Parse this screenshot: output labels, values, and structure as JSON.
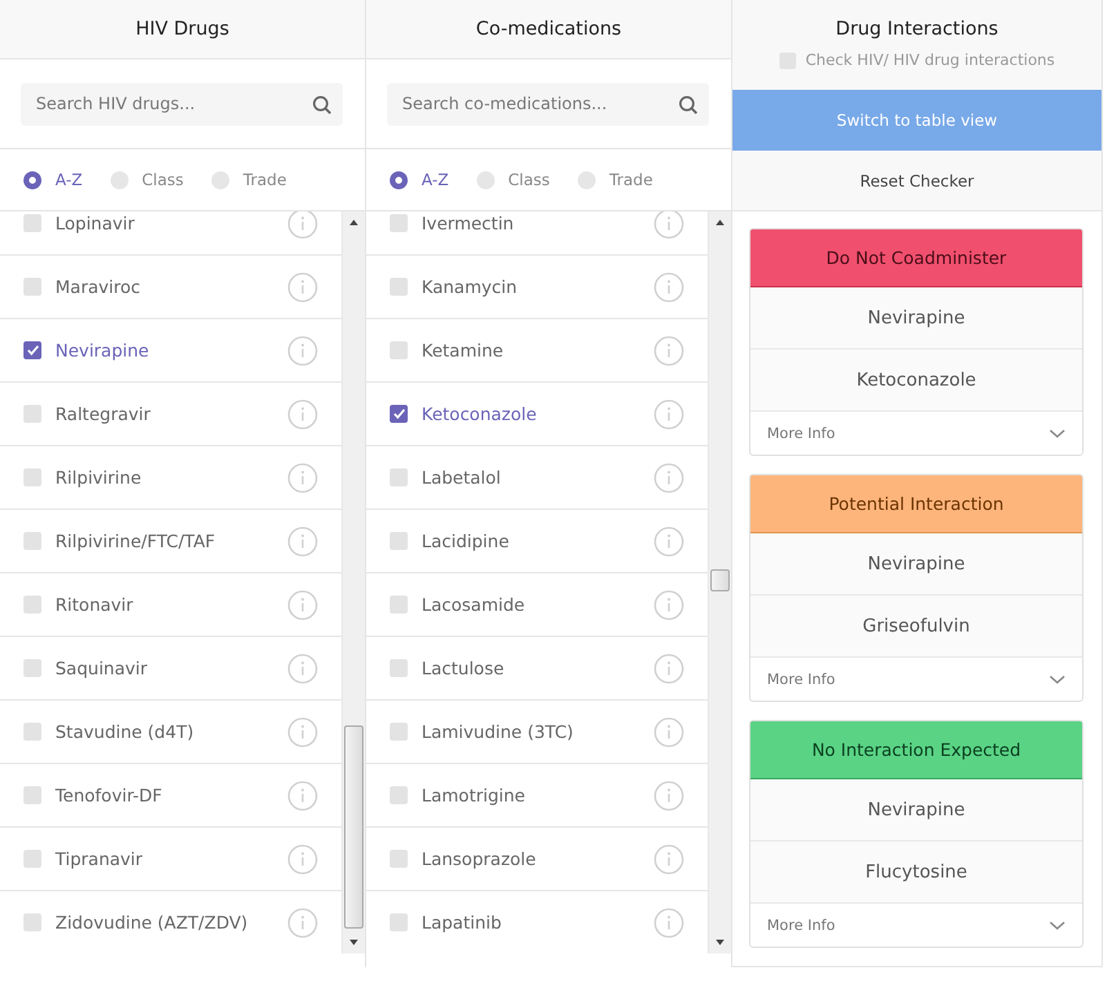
{
  "panels": [
    {
      "title": "HIV Drugs",
      "search": {
        "placeholder": "Search HIV drugs..."
      },
      "sort_options": [
        {
          "label": "A-Z",
          "selected": true
        },
        {
          "label": "Class",
          "selected": false
        },
        {
          "label": "Trade",
          "selected": false
        }
      ],
      "items": [
        {
          "name": "Lopinavir",
          "checked": false
        },
        {
          "name": "Maraviroc",
          "checked": false
        },
        {
          "name": "Nevirapine",
          "checked": true
        },
        {
          "name": "Raltegravir",
          "checked": false
        },
        {
          "name": "Rilpivirine",
          "checked": false
        },
        {
          "name": "Rilpivirine/FTC/TAF",
          "checked": false
        },
        {
          "name": "Ritonavir",
          "checked": false
        },
        {
          "name": "Saquinavir",
          "checked": false
        },
        {
          "name": "Stavudine (d4T)",
          "checked": false
        },
        {
          "name": "Tenofovir-DF",
          "checked": false
        },
        {
          "name": "Tipranavir",
          "checked": false
        },
        {
          "name": "Zidovudine (AZT/ZDV)",
          "checked": false
        }
      ]
    },
    {
      "title": "Co-medications",
      "search": {
        "placeholder": "Search co-medications..."
      },
      "sort_options": [
        {
          "label": "A-Z",
          "selected": true
        },
        {
          "label": "Class",
          "selected": false
        },
        {
          "label": "Trade",
          "selected": false
        }
      ],
      "items": [
        {
          "name": "Ivermectin",
          "checked": false
        },
        {
          "name": "Kanamycin",
          "checked": false
        },
        {
          "name": "Ketamine",
          "checked": false
        },
        {
          "name": "Ketoconazole",
          "checked": true
        },
        {
          "name": "Labetalol",
          "checked": false
        },
        {
          "name": "Lacidipine",
          "checked": false
        },
        {
          "name": "Lacosamide",
          "checked": false
        },
        {
          "name": "Lactulose",
          "checked": false
        },
        {
          "name": "Lamivudine (3TC)",
          "checked": false
        },
        {
          "name": "Lamotrigine",
          "checked": false
        },
        {
          "name": "Lansoprazole",
          "checked": false
        },
        {
          "name": "Lapatinib",
          "checked": false
        }
      ]
    }
  ],
  "interactions": {
    "title": "Drug Interactions",
    "hiv_check": {
      "label": "Check HIV/ HIV drug interactions",
      "checked": false
    },
    "table_view_button": "Switch to table view",
    "reset_button": "Reset Checker",
    "results": [
      {
        "kind": "danger",
        "label": "Do Not Coadminister",
        "color": "#f0506e",
        "drugs": [
          "Nevirapine",
          "Ketoconazole"
        ],
        "more_info": "More Info",
        "expanded": false
      },
      {
        "kind": "warning",
        "label": "Potential Interaction",
        "color": "#fdb57c",
        "drugs": [
          "Nevirapine",
          "Griseofulvin"
        ],
        "more_info": "More Info",
        "expanded": false
      },
      {
        "kind": "safe",
        "label": "No Interaction Expected",
        "color": "#5ad385",
        "drugs": [
          "Nevirapine",
          "Flucytosine"
        ],
        "more_info": "More Info",
        "expanded": false
      }
    ]
  }
}
